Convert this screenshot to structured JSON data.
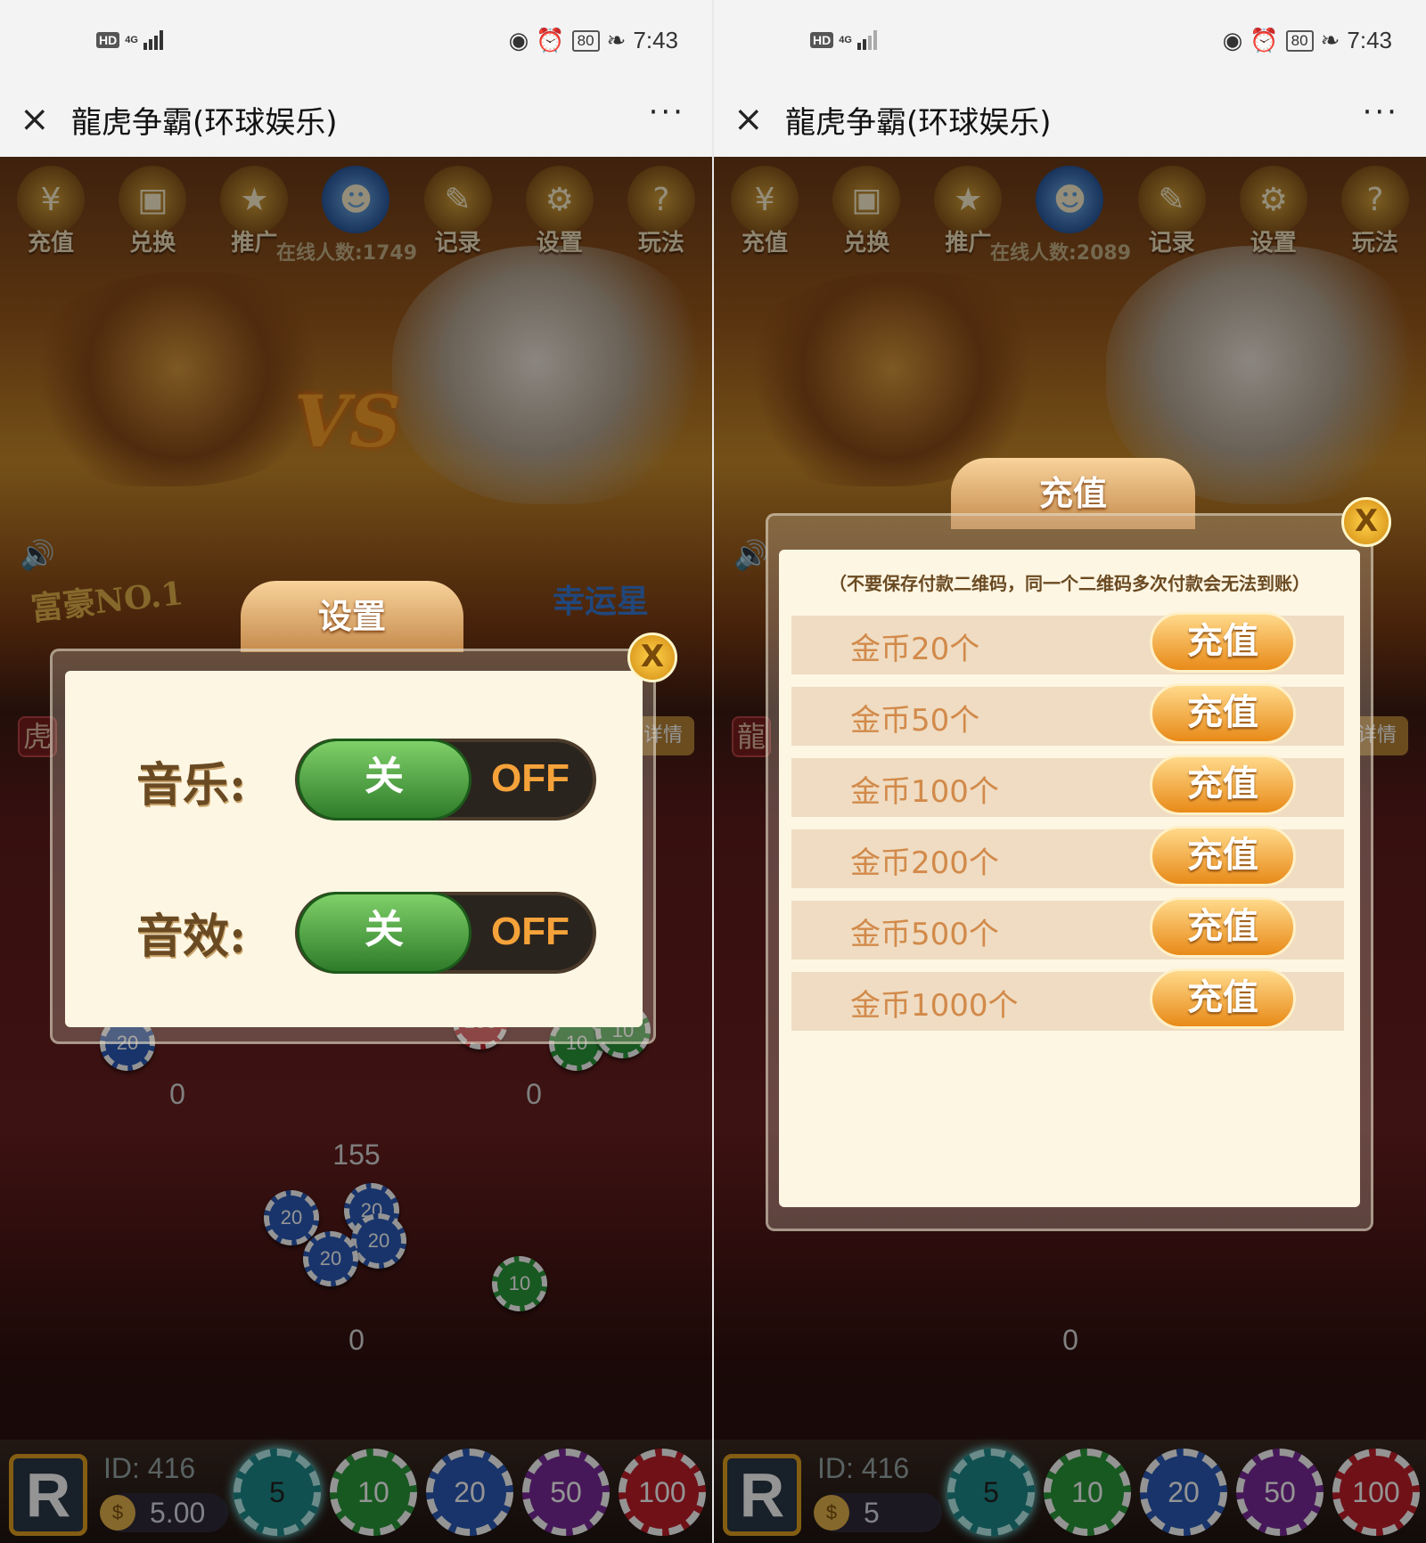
{
  "statusbar": {
    "hd": "HD",
    "net": "4G",
    "battery": "80",
    "time": "7:43"
  },
  "window": {
    "title": "龍虎争霸(环球娱乐)",
    "close_icon": "×",
    "more": "···"
  },
  "topnav": [
    {
      "label": "充值",
      "icon": "recharge-icon",
      "glyph": "¥"
    },
    {
      "label": "兑换",
      "icon": "wallet-icon",
      "glyph": "▣"
    },
    {
      "label": "推广",
      "icon": "promote-icon",
      "glyph": "★"
    },
    {
      "label": "",
      "icon": "people-icon",
      "glyph": "☻"
    },
    {
      "label": "记录",
      "icon": "record-icon",
      "glyph": "✎"
    },
    {
      "label": "设置",
      "icon": "gear-icon",
      "glyph": "⚙"
    },
    {
      "label": "玩法",
      "icon": "rules-icon",
      "glyph": "?"
    }
  ],
  "left": {
    "online": "在线人数:1749",
    "badge_left": "富豪NO.1",
    "badge_right": "幸运星",
    "side_tag": "虎",
    "detail": "详情",
    "bet_left": "0",
    "bet_right": "0",
    "pot_mid": "155",
    "pot_bottom": "0",
    "uid_label": "ID:",
    "uid_value": "416",
    "balance": "5.00",
    "settings": {
      "title": "设置",
      "close": "X",
      "music_label": "音乐:",
      "sound_label": "音效:",
      "on_text": "关",
      "off_text": "OFF"
    }
  },
  "right": {
    "online": "在线人数:2089",
    "side_tag": "龍",
    "detail": "详情",
    "pot_bottom": "0",
    "uid_label": "ID:",
    "uid_value": "416",
    "balance": "5",
    "recharge": {
      "title": "充值",
      "close": "X",
      "notice": "（不要保存付款二维码，同一个二维码多次付款会无法到账）",
      "button": "充值",
      "items": [
        "金币20个",
        "金币50个",
        "金币100个",
        "金币200个",
        "金币500个",
        "金币1000个"
      ]
    }
  },
  "chips": [
    "5",
    "10",
    "20",
    "50",
    "100"
  ],
  "colors": {
    "chip5": "#1e8a8a",
    "chip10": "#2a9a3a",
    "chip20": "#2a5ab8",
    "chip50": "#7a2a9a",
    "chip100": "#c21e2a"
  }
}
